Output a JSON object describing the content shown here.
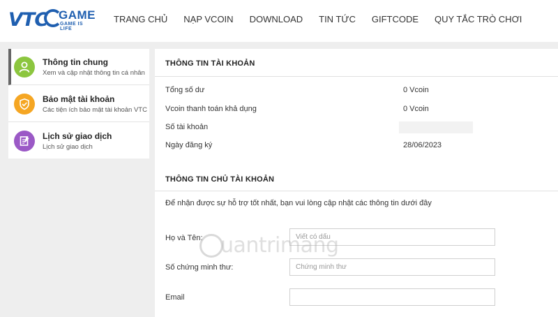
{
  "header": {
    "logo": {
      "brand": "VTC",
      "product": "GAME",
      "tagline": "GAME IS LIFE"
    },
    "nav": [
      "TRANG CHỦ",
      "NẠP VCOIN",
      "DOWNLOAD",
      "TIN TỨC",
      "GIFTCODE",
      "QUY TẮC TRÒ CHƠI"
    ]
  },
  "sidebar": {
    "items": [
      {
        "title": "Thông tin chung",
        "subtitle": "Xem và cập nhật thông tin cá nhân",
        "icon": "user-icon",
        "color": "#8cc63f",
        "active": true
      },
      {
        "title": "Bảo mật tài khoản",
        "subtitle": "Các tiện ích bảo mật tài khoản VTC",
        "icon": "shield-icon",
        "color": "#f5a623",
        "active": false
      },
      {
        "title": "Lịch sử giao dịch",
        "subtitle": "Lịch sử giao dịch",
        "icon": "history-icon",
        "color": "#9b59c6",
        "active": false
      }
    ]
  },
  "account_info": {
    "title": "THÔNG TIN TÀI KHOẢN",
    "rows": [
      {
        "label": "Tổng số dư",
        "value": "0 Vcoin"
      },
      {
        "label": "Vcoin thanh toán khả dụng",
        "value": "0 Vcoin"
      },
      {
        "label": "Số tài khoản",
        "value": ""
      },
      {
        "label": "Ngày đăng ký",
        "value": "28/06/2023"
      }
    ]
  },
  "owner_info": {
    "title": "THÔNG TIN CHỦ TÀI KHOẢN",
    "note": "Để nhận được sự hỗ trợ tốt nhất, bạn vui lòng cập nhật các thông tin dưới đây",
    "fields": [
      {
        "label": "Họ và Tên:",
        "placeholder": "Viết có dấu",
        "value": ""
      },
      {
        "label": "Số chứng minh thư:",
        "placeholder": "Chứng minh thư",
        "value": ""
      },
      {
        "label": "Email",
        "placeholder": "",
        "value": ""
      }
    ]
  },
  "watermark": {
    "text": "uantrimang"
  }
}
